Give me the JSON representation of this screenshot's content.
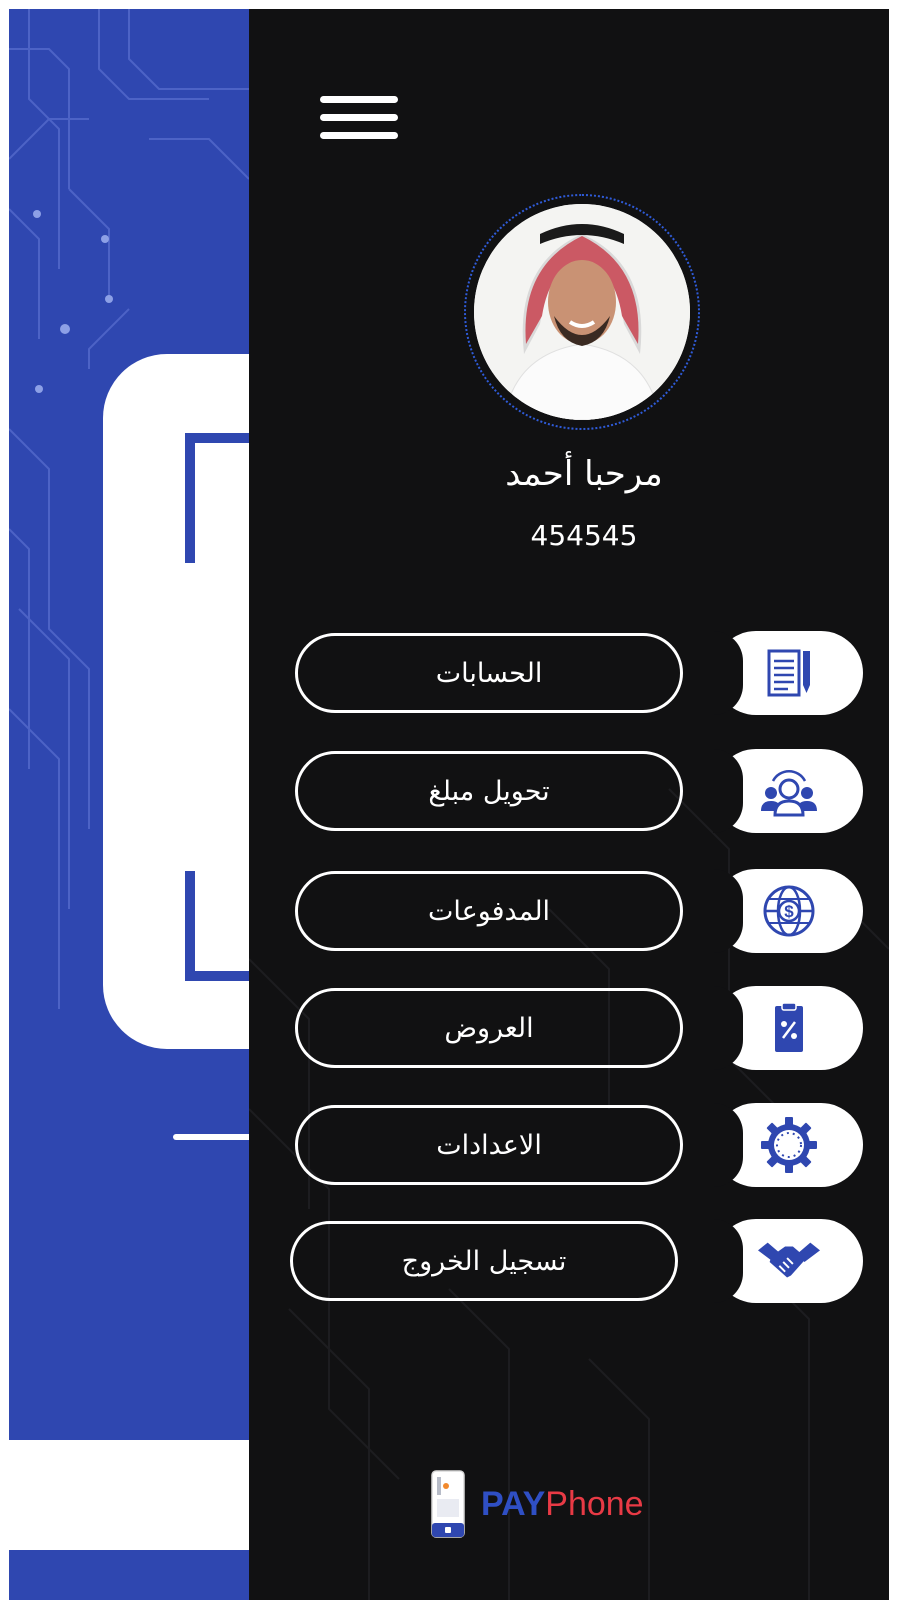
{
  "user": {
    "greeting": "مرحبا أحمد",
    "id": "454545"
  },
  "menu": [
    {
      "label": "الحسابات",
      "icon": "document-pen-icon"
    },
    {
      "label": "تحويل مبلغ",
      "icon": "users-transfer-icon"
    },
    {
      "label": "المدفوعات",
      "icon": "globe-dollar-icon"
    },
    {
      "label": "العروض",
      "icon": "clipboard-percent-icon"
    },
    {
      "label": "الاعدادات",
      "icon": "gear-icon"
    },
    {
      "label": "تسجيل الخروج",
      "icon": "handshake-icon"
    }
  ],
  "brand": {
    "pay": "PAY",
    "phone": "Phone"
  },
  "colors": {
    "drawer_bg": "#111112",
    "accent_blue": "#2f47b0",
    "logo_blue": "#2f4fc4",
    "logo_red": "#e83a45"
  }
}
